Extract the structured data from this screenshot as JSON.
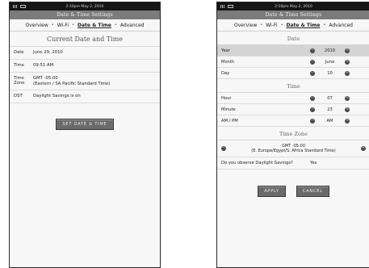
{
  "left": {
    "status": {
      "time": "2:10pm May 2, 2010"
    },
    "title": "Date & Time Settings",
    "tabs": [
      "Overview",
      "Wi-Fi",
      "Date & Time",
      "Advanced"
    ],
    "section_title": "Current Date and Time",
    "rows": [
      {
        "label": "Date",
        "value": "June 29, 2010"
      },
      {
        "label": "Time",
        "value": "09:51 AM"
      },
      {
        "label": "Time Zone",
        "value": "GMT -05:00\n(Eastern / SA Pacific Standard Time)"
      },
      {
        "label": "DST",
        "value": "Daylight Savings is on"
      }
    ],
    "button": "SET DATE & TIME"
  },
  "right": {
    "status": {
      "time": "2:10pm May 2, 2010"
    },
    "title": "Date & Time Settings",
    "tabs": [
      "Overview",
      "Wi-Fi",
      "Date & Time",
      "Advanced"
    ],
    "date_title": "Date",
    "date_rows": [
      {
        "label": "Year",
        "value": "2010"
      },
      {
        "label": "Month",
        "value": "June"
      },
      {
        "label": "Day",
        "value": "10"
      }
    ],
    "time_title": "Time",
    "time_rows": [
      {
        "label": "Hour",
        "value": "07"
      },
      {
        "label": "Minute",
        "value": "23"
      },
      {
        "label": "AM / PM",
        "value": "AM"
      }
    ],
    "tz_title": "Time Zone",
    "tz_value": "GMT -05:00\n(E. Europe/Egypt/S. Africa Standard Time)",
    "dst_question": "Do you observe Daylight Savings?",
    "dst_answer": "Yes",
    "apply": "APPLY",
    "cancel": "CANCEL"
  },
  "icons": {
    "signal": "signal-icon",
    "battery": "battery-icon",
    "decrement": "minus-circle-icon",
    "increment": "plus-circle-icon"
  }
}
